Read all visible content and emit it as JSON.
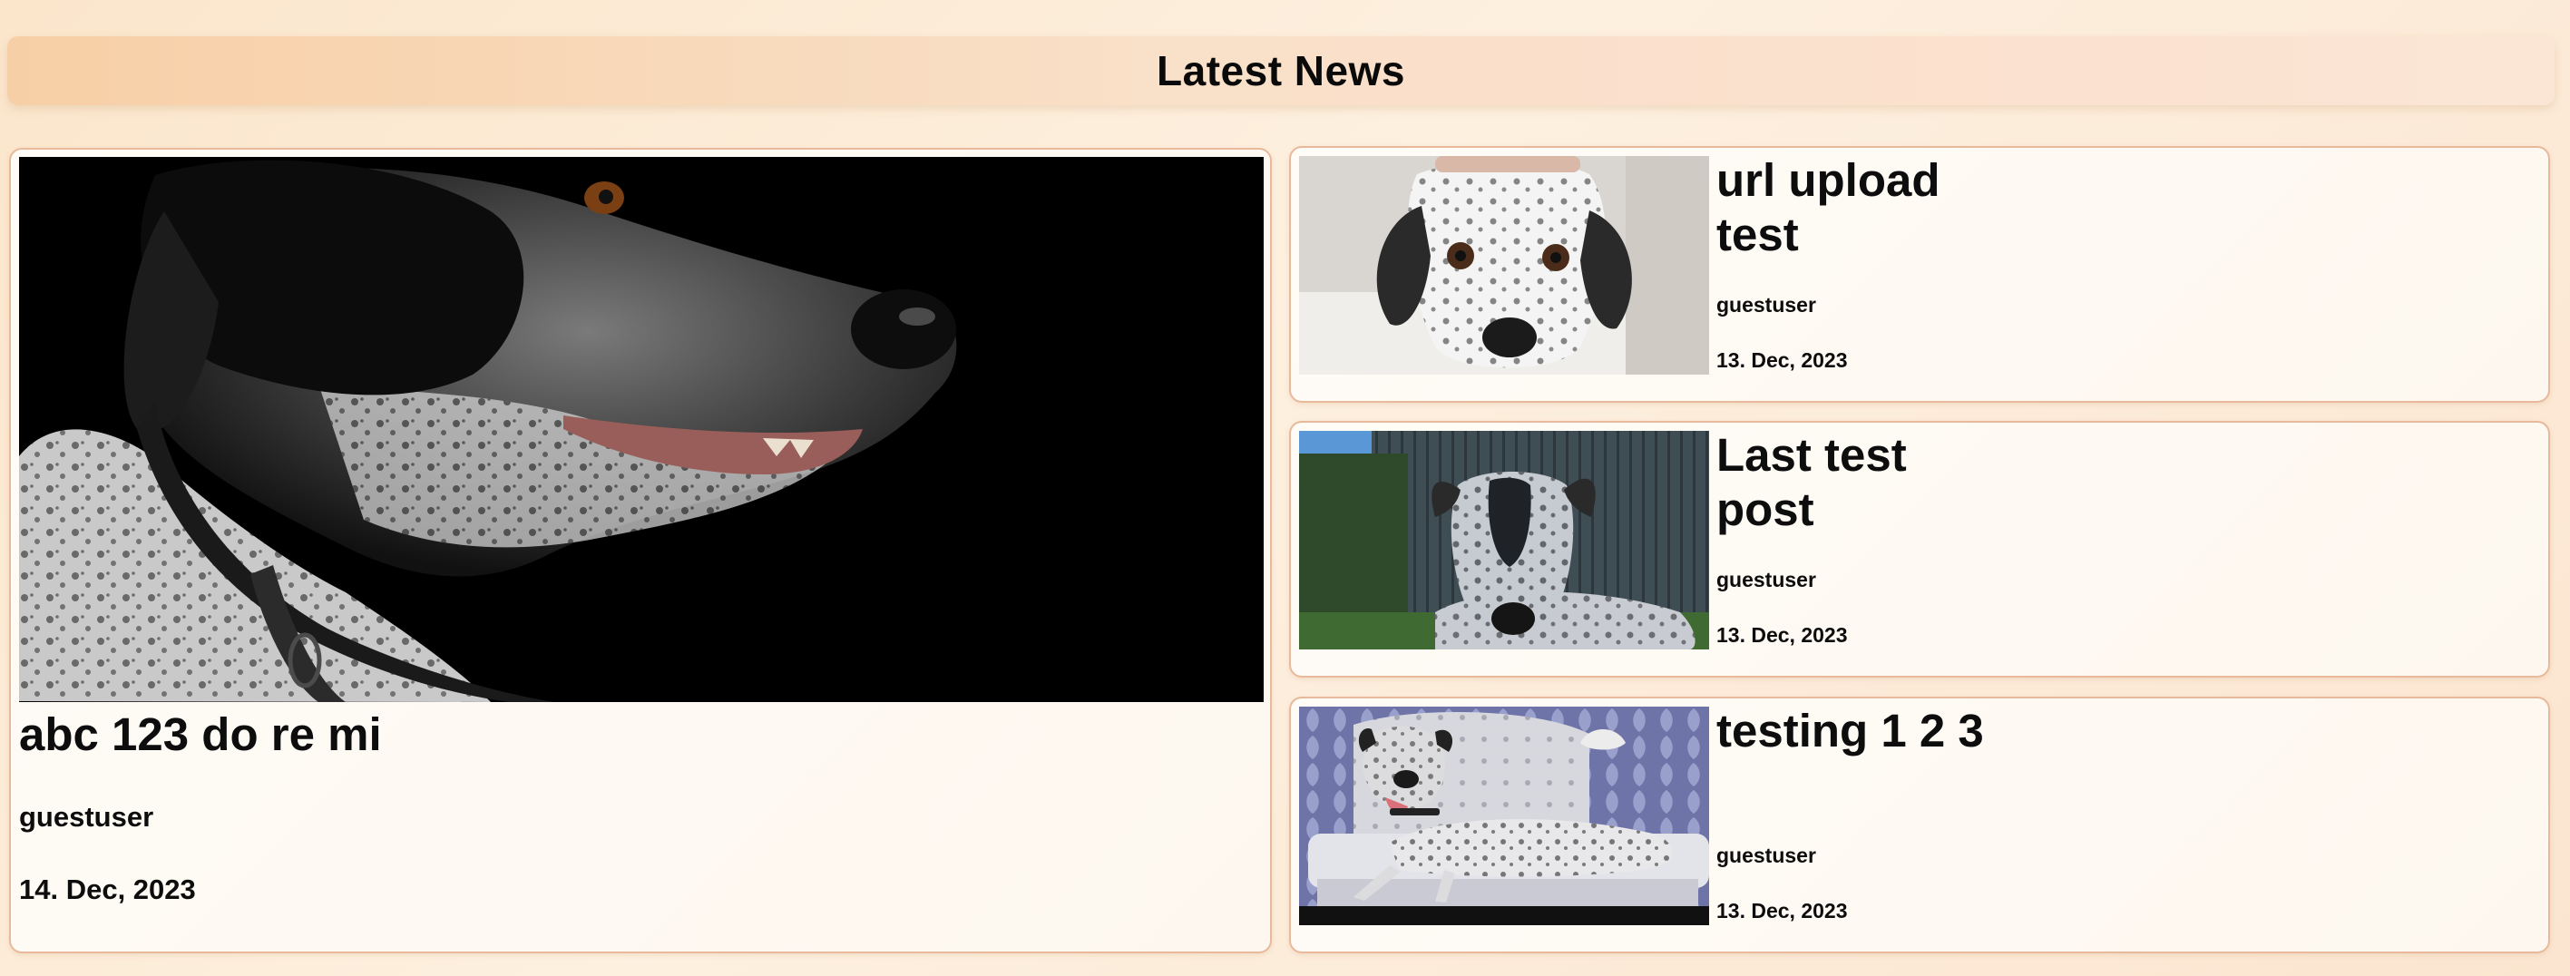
{
  "header": {
    "title": "Latest News"
  },
  "featured": {
    "title": "abc 123 do re mi",
    "author": "guestuser",
    "date": "14. Dec, 2023",
    "image": "photo-dalmatian-profile-black-background"
  },
  "posts": [
    {
      "title": "url upload test",
      "author": "guestuser",
      "date": "13. Dec, 2023",
      "image": "photo-dalmatian-face"
    },
    {
      "title": "Last test post",
      "author": "guestuser",
      "date": "13. Dec, 2023",
      "image": "photo-spotted-dog-in-garden"
    },
    {
      "title": "testing 1 2 3",
      "author": "guestuser",
      "date": "13. Dec, 2023",
      "image": "photo-spotted-dog-on-sofa"
    }
  ]
}
